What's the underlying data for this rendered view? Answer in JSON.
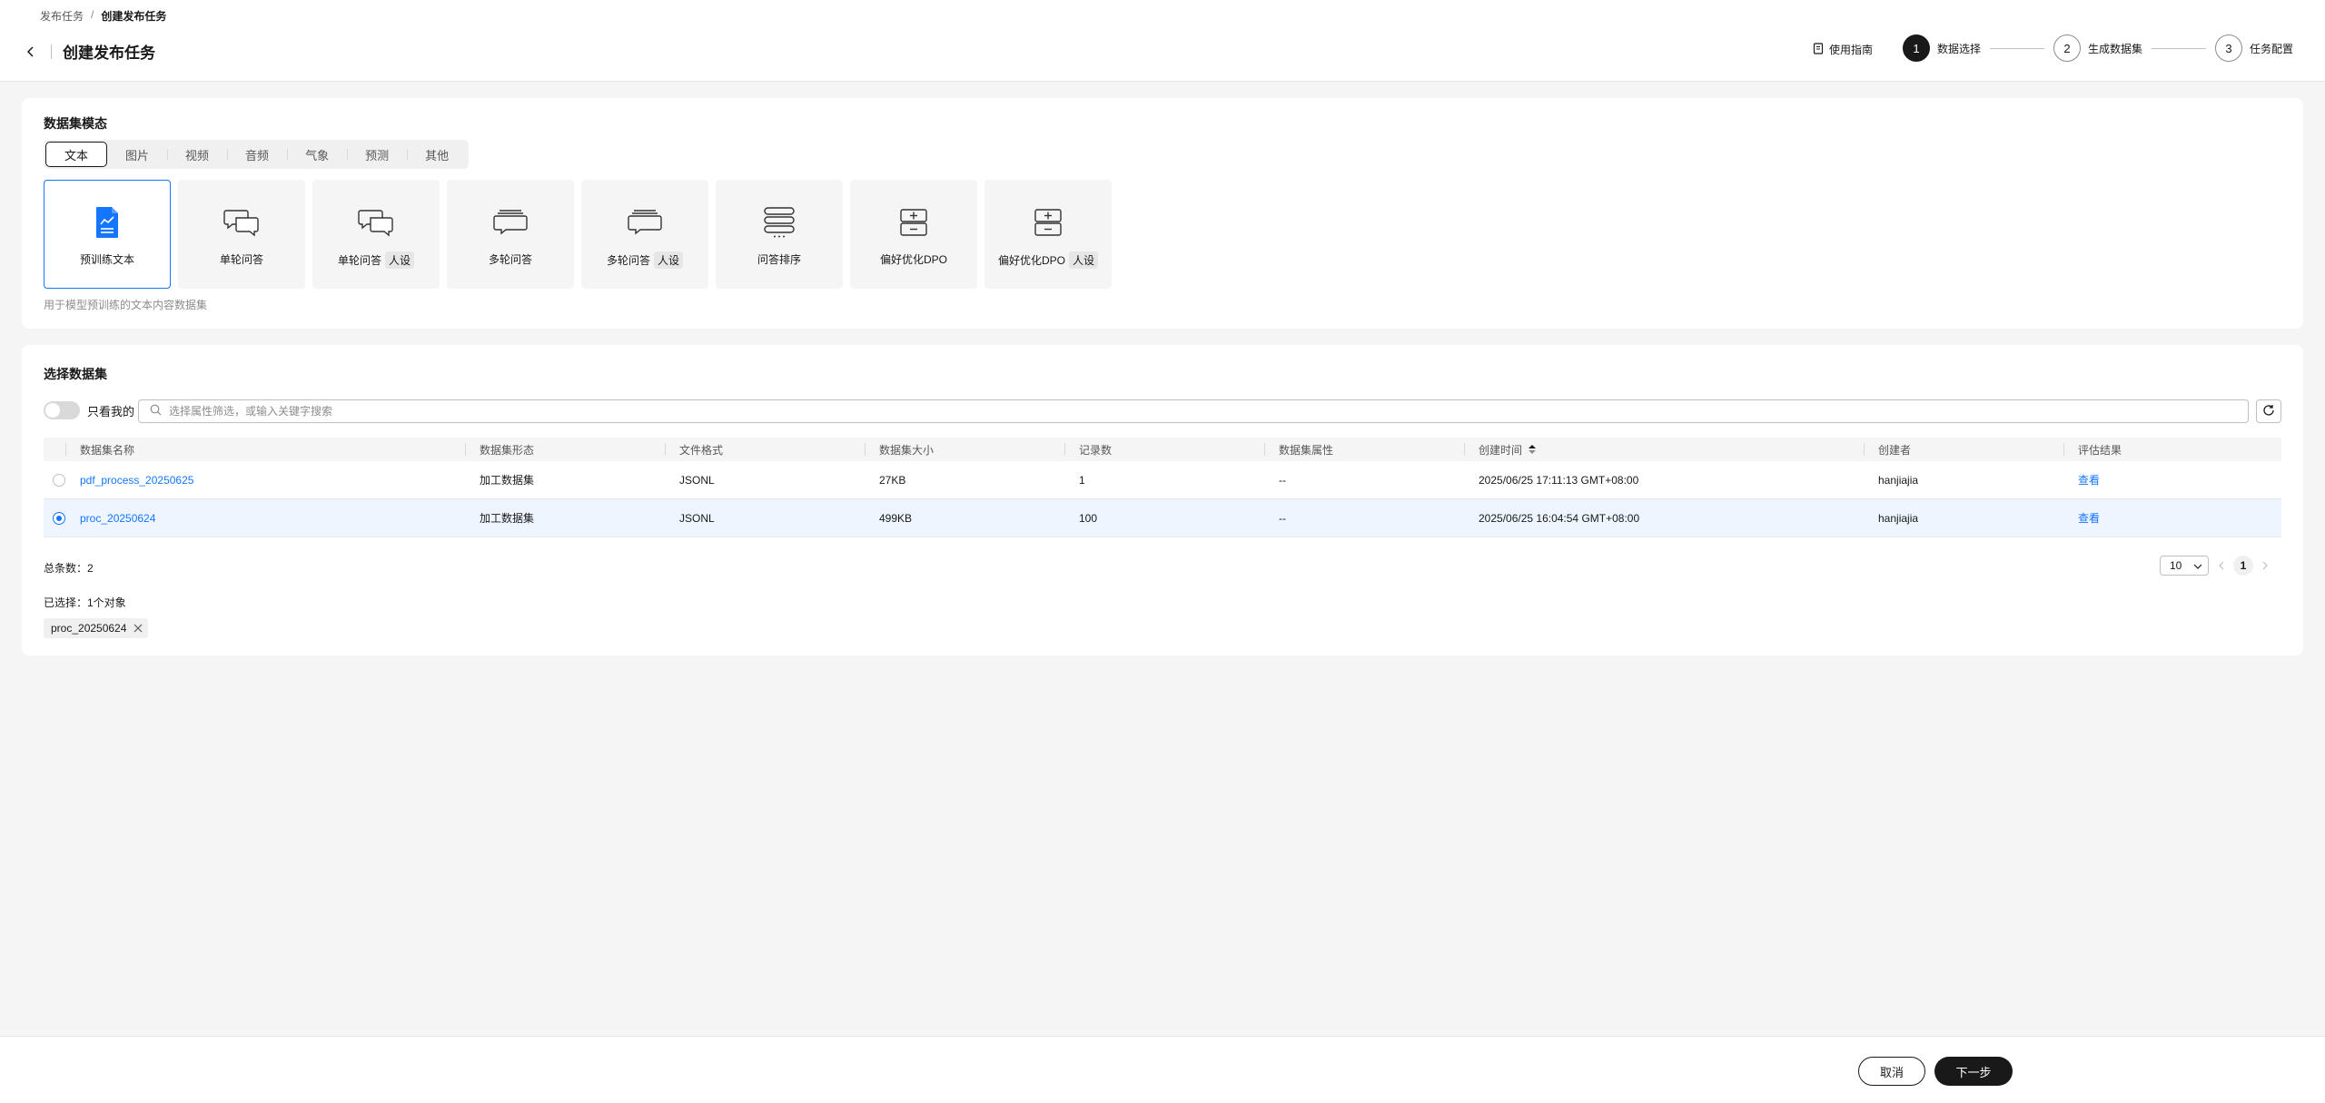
{
  "breadcrumb": {
    "parent": "发布任务",
    "separator": "/",
    "current": "创建发布任务"
  },
  "header": {
    "title": "创建发布任务",
    "guide_label": "使用指南"
  },
  "steps": [
    {
      "num": "1",
      "label": "数据选择"
    },
    {
      "num": "2",
      "label": "生成数据集"
    },
    {
      "num": "3",
      "label": "任务配置"
    }
  ],
  "modality": {
    "title": "数据集模态",
    "tabs": [
      "文本",
      "图片",
      "视频",
      "音频",
      "气象",
      "预测",
      "其他"
    ],
    "active_tab": "文本",
    "types": [
      {
        "label": "预训练文本",
        "tag": ""
      },
      {
        "label": "单轮问答",
        "tag": ""
      },
      {
        "label": "单轮问答",
        "tag": "人设"
      },
      {
        "label": "多轮问答",
        "tag": ""
      },
      {
        "label": "多轮问答",
        "tag": "人设"
      },
      {
        "label": "问答排序",
        "tag": ""
      },
      {
        "label": "偏好优化DPO",
        "tag": ""
      },
      {
        "label": "偏好优化DPO",
        "tag": "人设"
      }
    ],
    "description": "用于模型预训练的文本内容数据集"
  },
  "dataset": {
    "title": "选择数据集",
    "only_mine_label": "只看我的",
    "search_placeholder": "选择属性筛选，或输入关键字搜索",
    "columns": [
      "数据集名称",
      "数据集形态",
      "文件格式",
      "数据集大小",
      "记录数",
      "数据集属性",
      "创建时间",
      "创建者",
      "评估结果"
    ],
    "rows": [
      {
        "name": "pdf_process_20250625",
        "form": "加工数据集",
        "format": "JSONL",
        "size": "27KB",
        "records": "1",
        "attr": "--",
        "time": "2025/06/25 17:11:13 GMT+08:00",
        "creator": "hanjiajia",
        "eval": "查看"
      },
      {
        "name": "proc_20250624",
        "form": "加工数据集",
        "format": "JSONL",
        "size": "499KB",
        "records": "100",
        "attr": "--",
        "time": "2025/06/25 16:04:54 GMT+08:00",
        "creator": "hanjiajia",
        "eval": "查看"
      }
    ],
    "total_label": "总条数：2",
    "page_size": "10",
    "current_page": "1",
    "selected_label": "已选择：1个对象",
    "selected_chip": "proc_20250624"
  },
  "footer": {
    "cancel_label": "取消",
    "next_label": "下一步"
  },
  "colors": {
    "accent": "#1476ff",
    "primary_button": "#191919"
  }
}
